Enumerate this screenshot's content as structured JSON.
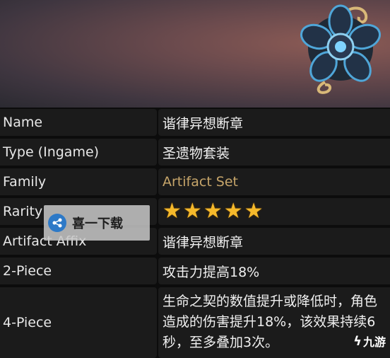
{
  "rows": [
    {
      "label": "Name",
      "value": "谐律异想断章"
    },
    {
      "label": "Type (Ingame)",
      "value": "圣遗物套装"
    },
    {
      "label": "Family",
      "value": "Artifact Set"
    },
    {
      "label": "Rarity",
      "value": "★★★★★",
      "stars": 5
    },
    {
      "label": "Artifact Affix",
      "value": "谐律异想断章"
    },
    {
      "label": "2-Piece",
      "value": "攻击力提高18%"
    },
    {
      "label": "4-Piece",
      "value": "生命之契的数值提升或降低时，角色造成的伤害提升18%，该效果持续6秒，至多叠加3次。"
    }
  ],
  "colors": {
    "row_bg": "#1b1b1b",
    "family_value": "#c6a56a",
    "star": "#f5b92b",
    "banner": "#6a4a4d"
  },
  "watermark": {
    "text": "喜一下载",
    "icon": "share-icon"
  },
  "corner_logo": {
    "text": "九游",
    "icon": "jiuyou-logo-icon"
  }
}
